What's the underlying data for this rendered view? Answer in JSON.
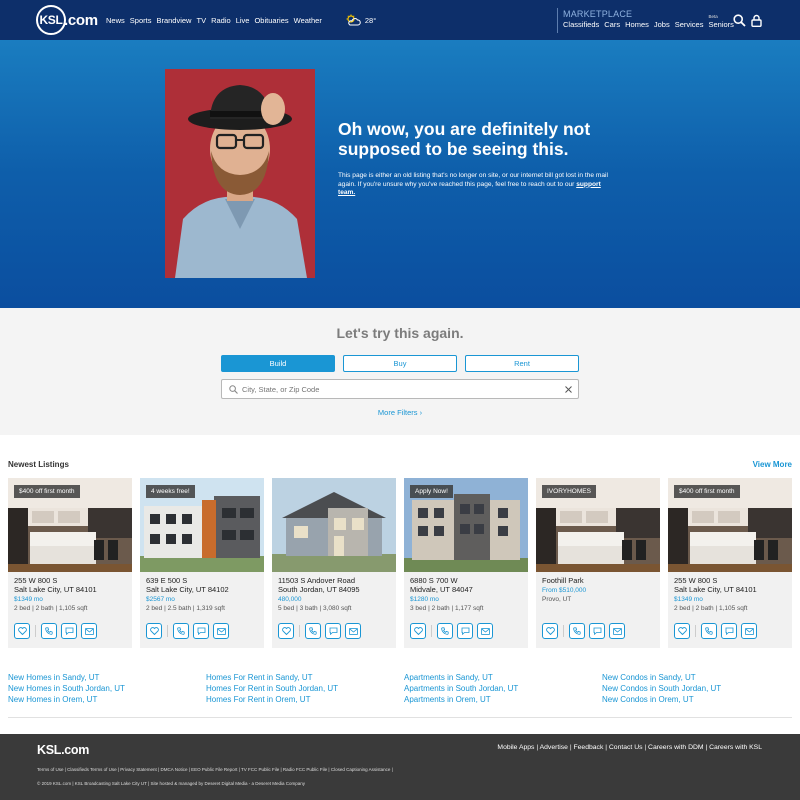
{
  "header": {
    "logo_mark": "KSL",
    "logo_text": ".com",
    "nav": [
      "News",
      "Sports",
      "Brandview",
      "TV",
      "Radio",
      "Live",
      "Obituaries",
      "Weather"
    ],
    "temperature": "28°",
    "marketplace_label": "MARKETPLACE",
    "marketplace_nav": [
      "Classifieds",
      "Cars",
      "Homes",
      "Jobs",
      "Services",
      "Seniors"
    ],
    "beta_label": "Beta"
  },
  "hero": {
    "title": "Oh wow, you are definitely not supposed to be seeing this.",
    "body": "This page is either an old listing that's no longer on site, or our internet bill got lost in the mail again. If you're unsure why you've reached this page, feel free to reach out to our",
    "link": "support team."
  },
  "search": {
    "title": "Let's try this again.",
    "tabs": [
      "Build",
      "Buy",
      "Rent"
    ],
    "active_tab": "Build",
    "placeholder": "City, State, or Zip Code",
    "more_filters": "More Filters ›"
  },
  "listings": {
    "title": "Newest Listings",
    "view_more": "View More",
    "cards": [
      {
        "badge": "$400 off first month",
        "line1": "255 W 800 S",
        "line2": "Salt Lake City, UT 84101",
        "price": "$1349 mo",
        "info": "2 bed | 2 bath | 1,105 sqft",
        "img": "interior"
      },
      {
        "badge": "4 weeks free!",
        "line1": "639 E 500 S",
        "line2": "Salt Lake City, UT 84102",
        "price": "$2567 mo",
        "info": "2 bed | 2.5 bath | 1,319 sqft",
        "img": "townhouse"
      },
      {
        "badge": "",
        "line1": "11503 S Andover Road",
        "line2": "South Jordan, UT 84095",
        "price": "480,000",
        "info": "5 bed | 3 bath | 3,080 sqft",
        "img": "house"
      },
      {
        "badge": "Apply Now!",
        "line1": "6880 S 700 W",
        "line2": "Midvale, UT 84047",
        "price": "$1280 mo",
        "info": "3 bed | 2 bath | 1,177 sqft",
        "img": "apartment"
      },
      {
        "badge": "IVORYHOMES",
        "line1": "Foothill Park",
        "line2": "",
        "price": "From $510,000",
        "info": "Provo, UT",
        "img": "interior"
      },
      {
        "badge": "$400 off first month",
        "line1": "255 W 800 S",
        "line2": "Salt Lake City, UT 84101",
        "price": "$1349 mo",
        "info": "2 bed | 2 bath | 1,105 sqft",
        "img": "interior"
      }
    ]
  },
  "links": [
    [
      "New Homes in Sandy, UT",
      "New Homes in South Jordan, UT",
      "New Homes in Orem, UT"
    ],
    [
      "Homes For Rent in Sandy, UT",
      "Homes For Rent in South Jordan, UT",
      "Homes For Rent in Orem, UT"
    ],
    [
      "Apartments in Sandy, UT",
      "Apartments in South Jordan, UT",
      "Apartments in Orem, UT"
    ],
    [
      "New Condos in Sandy, UT",
      "New Condos in South Jordan, UT",
      "New Condos in Orem, UT"
    ]
  ],
  "footer": {
    "logo": "KSL.com",
    "links": "Mobile Apps | Advertise | Feedback | Contact Us | Careers with DDM | Careers with KSL",
    "legal": "Terms of Use | Classifieds Terms of Use | Privacy Statement | DMCA Notice | EEO Public File Report | TV FCC Public File | Radio FCC Public File | Closed Captioning Assistance |",
    "copyright": "© 2019 KSL.com | KSL Broadcasting Salt Lake City UT | Site hosted & managed by Deseret Digital Media - a Deseret Media Company"
  },
  "colors": {
    "header": "#0d2f6a",
    "accent": "#1a96d4",
    "hero": "#0e5eaa",
    "footer": "#3a3a3a"
  }
}
